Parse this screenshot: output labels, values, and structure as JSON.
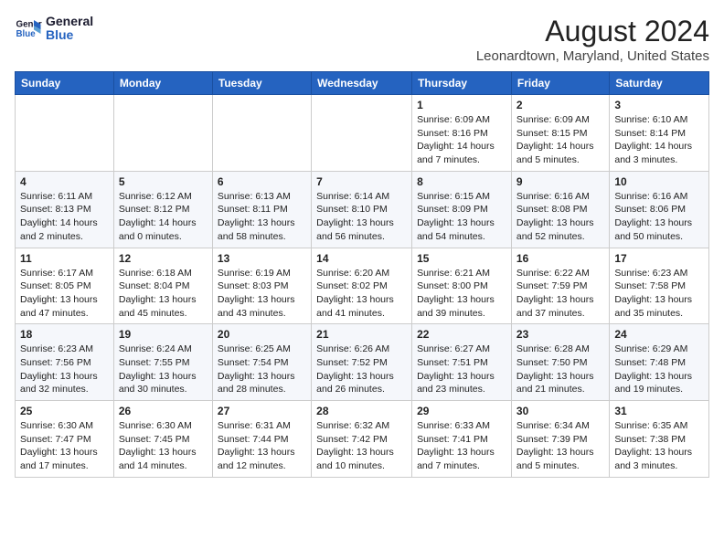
{
  "logo": {
    "line1": "General",
    "line2": "Blue"
  },
  "title": "August 2024",
  "subtitle": "Leonardtown, Maryland, United States",
  "days_of_week": [
    "Sunday",
    "Monday",
    "Tuesday",
    "Wednesday",
    "Thursday",
    "Friday",
    "Saturday"
  ],
  "weeks": [
    [
      {
        "day": "",
        "content": ""
      },
      {
        "day": "",
        "content": ""
      },
      {
        "day": "",
        "content": ""
      },
      {
        "day": "",
        "content": ""
      },
      {
        "day": "1",
        "content": "Sunrise: 6:09 AM\nSunset: 8:16 PM\nDaylight: 14 hours and 7 minutes."
      },
      {
        "day": "2",
        "content": "Sunrise: 6:09 AM\nSunset: 8:15 PM\nDaylight: 14 hours and 5 minutes."
      },
      {
        "day": "3",
        "content": "Sunrise: 6:10 AM\nSunset: 8:14 PM\nDaylight: 14 hours and 3 minutes."
      }
    ],
    [
      {
        "day": "4",
        "content": "Sunrise: 6:11 AM\nSunset: 8:13 PM\nDaylight: 14 hours and 2 minutes."
      },
      {
        "day": "5",
        "content": "Sunrise: 6:12 AM\nSunset: 8:12 PM\nDaylight: 14 hours and 0 minutes."
      },
      {
        "day": "6",
        "content": "Sunrise: 6:13 AM\nSunset: 8:11 PM\nDaylight: 13 hours and 58 minutes."
      },
      {
        "day": "7",
        "content": "Sunrise: 6:14 AM\nSunset: 8:10 PM\nDaylight: 13 hours and 56 minutes."
      },
      {
        "day": "8",
        "content": "Sunrise: 6:15 AM\nSunset: 8:09 PM\nDaylight: 13 hours and 54 minutes."
      },
      {
        "day": "9",
        "content": "Sunrise: 6:16 AM\nSunset: 8:08 PM\nDaylight: 13 hours and 52 minutes."
      },
      {
        "day": "10",
        "content": "Sunrise: 6:16 AM\nSunset: 8:06 PM\nDaylight: 13 hours and 50 minutes."
      }
    ],
    [
      {
        "day": "11",
        "content": "Sunrise: 6:17 AM\nSunset: 8:05 PM\nDaylight: 13 hours and 47 minutes."
      },
      {
        "day": "12",
        "content": "Sunrise: 6:18 AM\nSunset: 8:04 PM\nDaylight: 13 hours and 45 minutes."
      },
      {
        "day": "13",
        "content": "Sunrise: 6:19 AM\nSunset: 8:03 PM\nDaylight: 13 hours and 43 minutes."
      },
      {
        "day": "14",
        "content": "Sunrise: 6:20 AM\nSunset: 8:02 PM\nDaylight: 13 hours and 41 minutes."
      },
      {
        "day": "15",
        "content": "Sunrise: 6:21 AM\nSunset: 8:00 PM\nDaylight: 13 hours and 39 minutes."
      },
      {
        "day": "16",
        "content": "Sunrise: 6:22 AM\nSunset: 7:59 PM\nDaylight: 13 hours and 37 minutes."
      },
      {
        "day": "17",
        "content": "Sunrise: 6:23 AM\nSunset: 7:58 PM\nDaylight: 13 hours and 35 minutes."
      }
    ],
    [
      {
        "day": "18",
        "content": "Sunrise: 6:23 AM\nSunset: 7:56 PM\nDaylight: 13 hours and 32 minutes."
      },
      {
        "day": "19",
        "content": "Sunrise: 6:24 AM\nSunset: 7:55 PM\nDaylight: 13 hours and 30 minutes."
      },
      {
        "day": "20",
        "content": "Sunrise: 6:25 AM\nSunset: 7:54 PM\nDaylight: 13 hours and 28 minutes."
      },
      {
        "day": "21",
        "content": "Sunrise: 6:26 AM\nSunset: 7:52 PM\nDaylight: 13 hours and 26 minutes."
      },
      {
        "day": "22",
        "content": "Sunrise: 6:27 AM\nSunset: 7:51 PM\nDaylight: 13 hours and 23 minutes."
      },
      {
        "day": "23",
        "content": "Sunrise: 6:28 AM\nSunset: 7:50 PM\nDaylight: 13 hours and 21 minutes."
      },
      {
        "day": "24",
        "content": "Sunrise: 6:29 AM\nSunset: 7:48 PM\nDaylight: 13 hours and 19 minutes."
      }
    ],
    [
      {
        "day": "25",
        "content": "Sunrise: 6:30 AM\nSunset: 7:47 PM\nDaylight: 13 hours and 17 minutes."
      },
      {
        "day": "26",
        "content": "Sunrise: 6:30 AM\nSunset: 7:45 PM\nDaylight: 13 hours and 14 minutes."
      },
      {
        "day": "27",
        "content": "Sunrise: 6:31 AM\nSunset: 7:44 PM\nDaylight: 13 hours and 12 minutes."
      },
      {
        "day": "28",
        "content": "Sunrise: 6:32 AM\nSunset: 7:42 PM\nDaylight: 13 hours and 10 minutes."
      },
      {
        "day": "29",
        "content": "Sunrise: 6:33 AM\nSunset: 7:41 PM\nDaylight: 13 hours and 7 minutes."
      },
      {
        "day": "30",
        "content": "Sunrise: 6:34 AM\nSunset: 7:39 PM\nDaylight: 13 hours and 5 minutes."
      },
      {
        "day": "31",
        "content": "Sunrise: 6:35 AM\nSunset: 7:38 PM\nDaylight: 13 hours and 3 minutes."
      }
    ]
  ]
}
